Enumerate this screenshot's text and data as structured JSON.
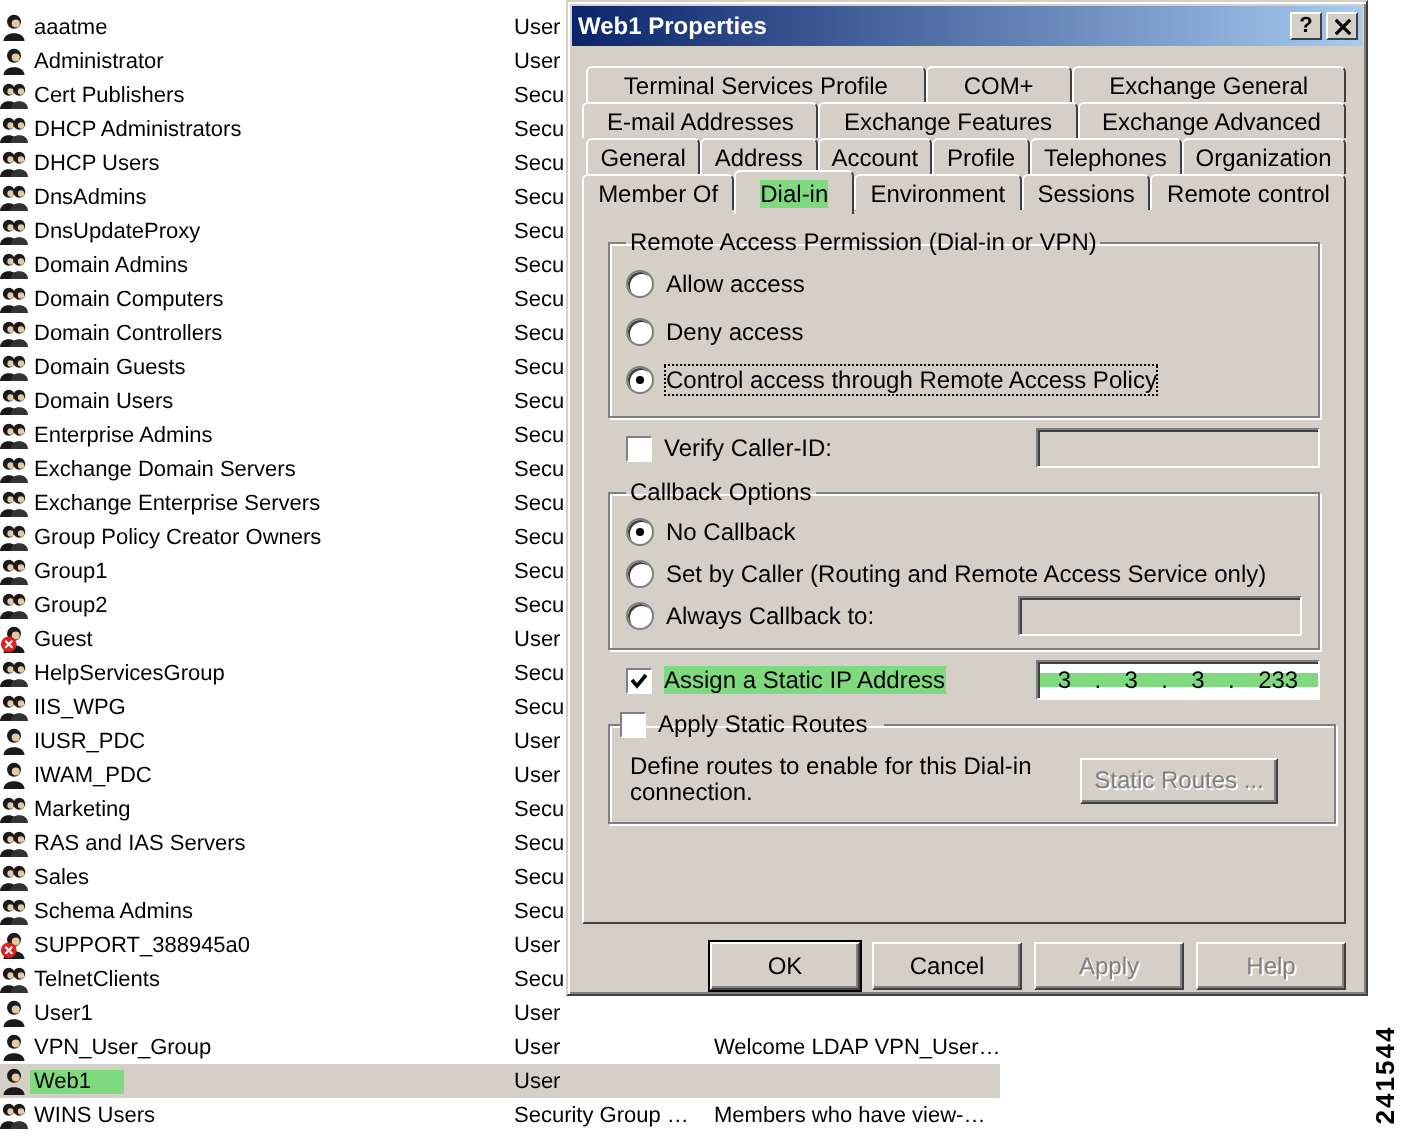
{
  "user_list": {
    "rows": [
      {
        "name": "aaatme",
        "type": "User",
        "kind": "user",
        "selected": false,
        "highlighted": false
      },
      {
        "name": "Administrator",
        "type": "User",
        "kind": "user",
        "selected": false,
        "highlighted": false
      },
      {
        "name": "Cert Publishers",
        "type": "Secu",
        "kind": "group",
        "selected": false,
        "highlighted": false
      },
      {
        "name": "DHCP Administrators",
        "type": "Secu",
        "kind": "group",
        "selected": false,
        "highlighted": false
      },
      {
        "name": "DHCP Users",
        "type": "Secu",
        "kind": "group",
        "selected": false,
        "highlighted": false
      },
      {
        "name": "DnsAdmins",
        "type": "Secu",
        "kind": "group",
        "selected": false,
        "highlighted": false
      },
      {
        "name": "DnsUpdateProxy",
        "type": "Secu",
        "kind": "group",
        "selected": false,
        "highlighted": false
      },
      {
        "name": "Domain Admins",
        "type": "Secu",
        "kind": "group",
        "selected": false,
        "highlighted": false
      },
      {
        "name": "Domain Computers",
        "type": "Secu",
        "kind": "group",
        "selected": false,
        "highlighted": false
      },
      {
        "name": "Domain Controllers",
        "type": "Secu",
        "kind": "group",
        "selected": false,
        "highlighted": false
      },
      {
        "name": "Domain Guests",
        "type": "Secu",
        "kind": "group",
        "selected": false,
        "highlighted": false
      },
      {
        "name": "Domain Users",
        "type": "Secu",
        "kind": "group",
        "selected": false,
        "highlighted": false
      },
      {
        "name": "Enterprise Admins",
        "type": "Secu",
        "kind": "group",
        "selected": false,
        "highlighted": false
      },
      {
        "name": "Exchange Domain Servers",
        "type": "Secu",
        "kind": "group",
        "selected": false,
        "highlighted": false
      },
      {
        "name": "Exchange Enterprise Servers",
        "type": "Secu",
        "kind": "group",
        "selected": false,
        "highlighted": false
      },
      {
        "name": "Group Policy Creator Owners",
        "type": "Secu",
        "kind": "group",
        "selected": false,
        "highlighted": false
      },
      {
        "name": "Group1",
        "type": "Secu",
        "kind": "group",
        "selected": false,
        "highlighted": false
      },
      {
        "name": "Group2",
        "type": "Secu",
        "kind": "group",
        "selected": false,
        "highlighted": false
      },
      {
        "name": "Guest",
        "type": "User",
        "kind": "disabled_user",
        "selected": false,
        "highlighted": false
      },
      {
        "name": "HelpServicesGroup",
        "type": "Secu",
        "kind": "group",
        "selected": false,
        "highlighted": false
      },
      {
        "name": "IIS_WPG",
        "type": "Secu",
        "kind": "group",
        "selected": false,
        "highlighted": false
      },
      {
        "name": "IUSR_PDC",
        "type": "User",
        "kind": "user",
        "selected": false,
        "highlighted": false
      },
      {
        "name": "IWAM_PDC",
        "type": "User",
        "kind": "user",
        "selected": false,
        "highlighted": false
      },
      {
        "name": "Marketing",
        "type": "Secu",
        "kind": "group",
        "selected": false,
        "highlighted": false
      },
      {
        "name": "RAS and IAS Servers",
        "type": "Secu",
        "kind": "group",
        "selected": false,
        "highlighted": false
      },
      {
        "name": "Sales",
        "type": "Secu",
        "kind": "group",
        "selected": false,
        "highlighted": false
      },
      {
        "name": "Schema Admins",
        "type": "Secu",
        "kind": "group",
        "selected": false,
        "highlighted": false
      },
      {
        "name": "SUPPORT_388945a0",
        "type": "User",
        "kind": "disabled_user",
        "selected": false,
        "highlighted": false
      },
      {
        "name": "TelnetClients",
        "type": "Secu",
        "kind": "group",
        "selected": false,
        "highlighted": false
      },
      {
        "name": "User1",
        "type": "User",
        "kind": "user",
        "selected": false,
        "highlighted": false
      },
      {
        "name": "VPN_User_Group",
        "type": "User",
        "description": "Welcome LDAP VPN_User…",
        "kind": "user",
        "selected": false,
        "highlighted": false
      },
      {
        "name": "Web1",
        "type": "User",
        "kind": "user",
        "selected": true,
        "highlighted": true
      },
      {
        "name": "WINS Users",
        "type": "Security Group …",
        "description": "Members who have view-…",
        "kind": "group",
        "selected": false,
        "highlighted": false
      }
    ]
  },
  "dialog": {
    "title": "Web1 Properties",
    "help_button": "?",
    "tab_rows": [
      [
        {
          "label": "Terminal Services Profile",
          "selected": false,
          "highlighted": false
        },
        {
          "label": "COM+",
          "selected": false,
          "highlighted": false
        },
        {
          "label": "Exchange General",
          "selected": false,
          "highlighted": false
        }
      ],
      [
        {
          "label": "E-mail Addresses",
          "selected": false,
          "highlighted": false
        },
        {
          "label": "Exchange Features",
          "selected": false,
          "highlighted": false
        },
        {
          "label": "Exchange Advanced",
          "selected": false,
          "highlighted": false
        }
      ],
      [
        {
          "label": "General",
          "selected": false,
          "highlighted": false
        },
        {
          "label": "Address",
          "selected": false,
          "highlighted": false
        },
        {
          "label": "Account",
          "selected": false,
          "highlighted": false
        },
        {
          "label": "Profile",
          "selected": false,
          "highlighted": false
        },
        {
          "label": "Telephones",
          "selected": false,
          "highlighted": false
        },
        {
          "label": "Organization",
          "selected": false,
          "highlighted": false
        }
      ],
      [
        {
          "label": "Member Of",
          "selected": false,
          "highlighted": false
        },
        {
          "label": "Dial-in",
          "selected": true,
          "highlighted": true
        },
        {
          "label": "Environment",
          "selected": false,
          "highlighted": false
        },
        {
          "label": "Sessions",
          "selected": false,
          "highlighted": false
        },
        {
          "label": "Remote control",
          "selected": false,
          "highlighted": false
        }
      ]
    ],
    "permission_group": {
      "title": "Remote Access Permission (Dial-in or VPN)",
      "options": [
        {
          "label": "Allow access",
          "selected": false
        },
        {
          "label": "Deny access",
          "selected": false
        },
        {
          "label": "Control access through Remote Access Policy",
          "selected": true
        }
      ]
    },
    "verify_caller_id": {
      "label": "Verify Caller-ID:",
      "checked": false
    },
    "callback_group": {
      "title": "Callback Options",
      "options": [
        {
          "label": "No Callback",
          "selected": true,
          "kind": "plain"
        },
        {
          "label": "Set by Caller (Routing and Remote Access Service only)",
          "selected": false,
          "kind": "plain"
        },
        {
          "label": "Always Callback to:",
          "selected": false,
          "kind": "with_field"
        }
      ]
    },
    "static_ip": {
      "label": "Assign a Static IP Address",
      "checked": true,
      "highlighted": true,
      "octets": [
        "3",
        "3",
        "3",
        "233"
      ],
      "separator": "."
    },
    "static_routes": {
      "label": "Apply Static Routes",
      "checked": false,
      "description": "Define routes to enable for this Dial-in connection.",
      "button": {
        "label": "Static Routes ...",
        "disabled": true
      }
    },
    "buttons": [
      {
        "label": "OK",
        "default": true,
        "disabled": false
      },
      {
        "label": "Cancel",
        "default": false,
        "disabled": false
      },
      {
        "label": "Apply",
        "default": false,
        "disabled": true
      },
      {
        "label": "Help",
        "default": false,
        "disabled": true
      }
    ]
  },
  "figure_number": "241544"
}
